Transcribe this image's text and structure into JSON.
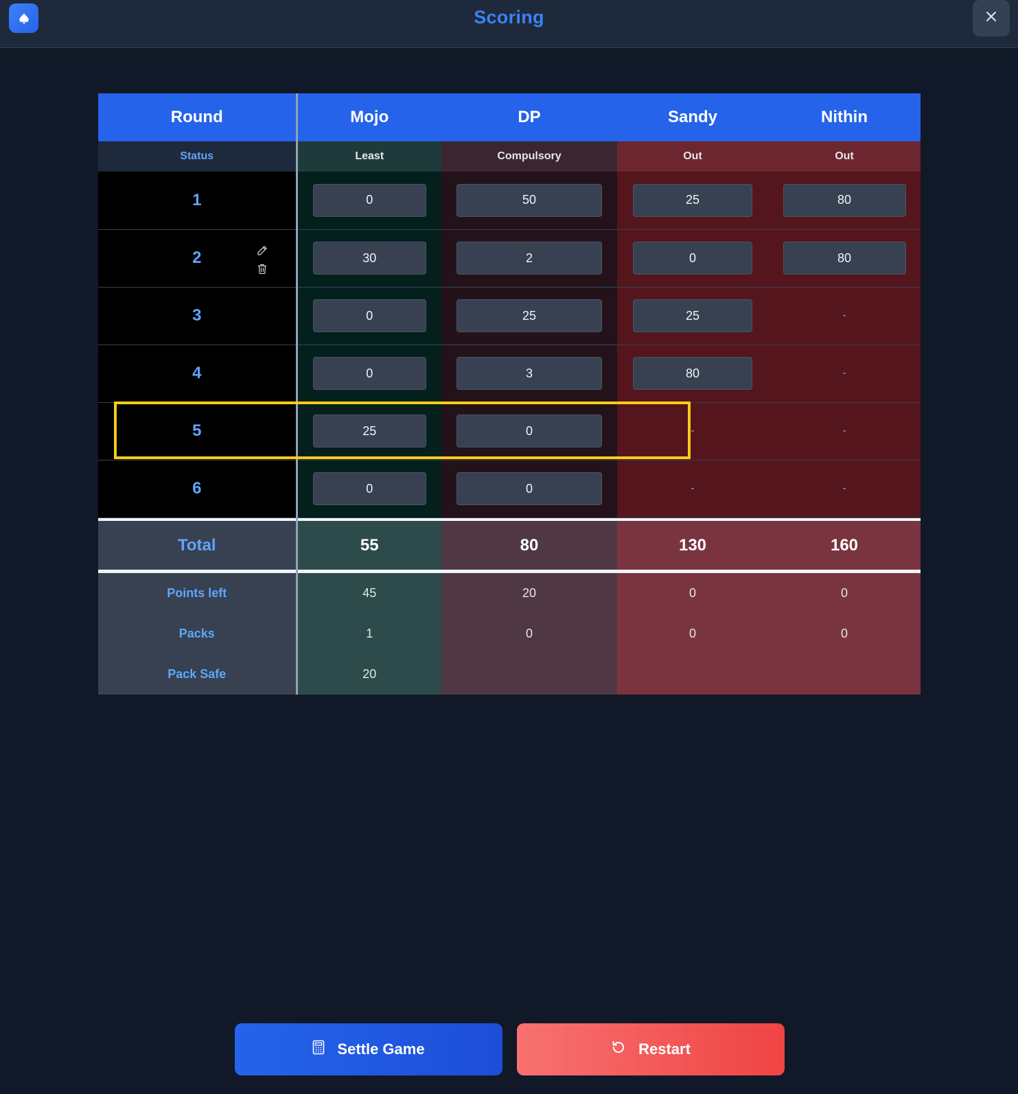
{
  "header": {
    "title": "Scoring",
    "app_icon": "spade-icon",
    "close_icon": "close-icon"
  },
  "table": {
    "headers": {
      "round": "Round",
      "players": [
        "Mojo",
        "DP",
        "Sandy",
        "Nithin"
      ]
    },
    "status": {
      "label": "Status",
      "values": [
        "Least",
        "Compulsory",
        "Out",
        "Out"
      ]
    },
    "rounds": [
      {
        "number": "1",
        "scores": [
          "0",
          "50",
          "25",
          "80"
        ]
      },
      {
        "number": "2",
        "scores": [
          "30",
          "2",
          "0",
          "80"
        ]
      },
      {
        "number": "3",
        "scores": [
          "0",
          "25",
          "25",
          "-"
        ]
      },
      {
        "number": "4",
        "scores": [
          "0",
          "3",
          "80",
          "-"
        ]
      },
      {
        "number": "5",
        "scores": [
          "25",
          "0",
          "-",
          "-"
        ]
      },
      {
        "number": "6",
        "scores": [
          "0",
          "0",
          "-",
          "-"
        ]
      }
    ],
    "total": {
      "label": "Total",
      "values": [
        "55",
        "80",
        "130",
        "160"
      ]
    },
    "points_left": {
      "label": "Points left",
      "values": [
        "45",
        "20",
        "0",
        "0"
      ]
    },
    "packs": {
      "label": "Packs",
      "values": [
        "1",
        "0",
        "0",
        "0"
      ]
    },
    "pack_safe": {
      "label": "Pack Safe",
      "values": [
        "20",
        "",
        "",
        ""
      ]
    },
    "highlighted_round": "5"
  },
  "actions": {
    "settle_label": "Settle Game",
    "restart_label": "Restart"
  },
  "colors": {
    "accent": "#2563eb",
    "highlight": "#facc15",
    "restart": "#ef4444"
  }
}
